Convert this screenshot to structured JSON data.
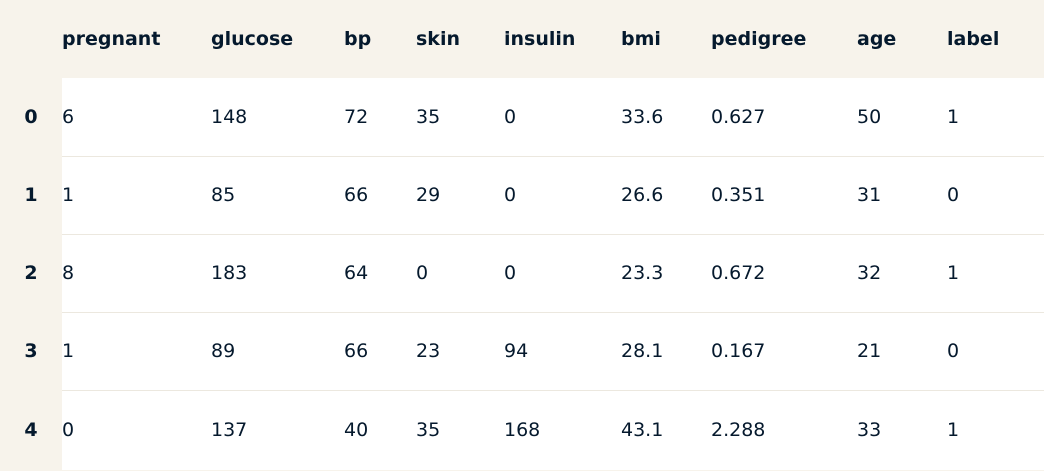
{
  "table": {
    "columns": [
      "pregnant",
      "glucose",
      "bp",
      "skin",
      "insulin",
      "bmi",
      "pedigree",
      "age",
      "label"
    ],
    "rows": [
      {
        "index": "0",
        "cells": [
          "6",
          "148",
          "72",
          "35",
          "0",
          "33.6",
          "0.627",
          "50",
          "1"
        ]
      },
      {
        "index": "1",
        "cells": [
          "1",
          "85",
          "66",
          "29",
          "0",
          "26.6",
          "0.351",
          "31",
          "0"
        ]
      },
      {
        "index": "2",
        "cells": [
          "8",
          "183",
          "64",
          "0",
          "0",
          "23.3",
          "0.672",
          "32",
          "1"
        ]
      },
      {
        "index": "3",
        "cells": [
          "1",
          "89",
          "66",
          "23",
          "94",
          "28.1",
          "0.167",
          "21",
          "0"
        ]
      },
      {
        "index": "4",
        "cells": [
          "0",
          "137",
          "40",
          "35",
          "168",
          "43.1",
          "2.288",
          "33",
          "1"
        ]
      }
    ]
  },
  "colors": {
    "header_bg": "#f7f3eb",
    "cell_bg": "#ffffff",
    "text": "#05192d"
  }
}
